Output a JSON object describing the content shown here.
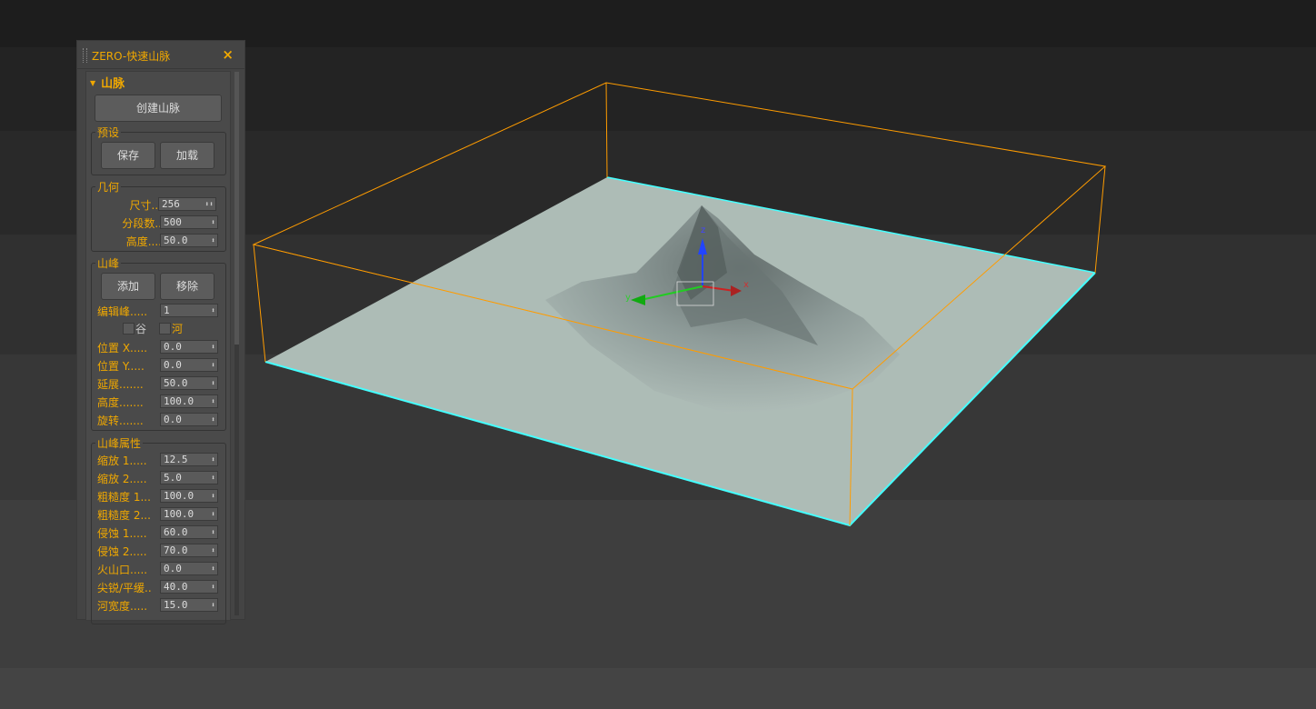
{
  "panel": {
    "title": "ZERO-快速山脉",
    "close": "×",
    "rollout": "山脉",
    "create_button": "创建山脉",
    "preset": {
      "label": "预设",
      "save": "保存",
      "load": "加载"
    },
    "geometry": {
      "label": "几何",
      "fields": [
        {
          "label": "尺寸...",
          "value": "256"
        },
        {
          "label": "分段数..",
          "value": "500"
        },
        {
          "label": "高度....",
          "value": "50.0"
        }
      ]
    },
    "peak": {
      "label": "山峰",
      "add": "添加",
      "remove": "移除",
      "edit_label": "编辑峰.....",
      "edit_value": "1",
      "valley": "谷",
      "river": "河",
      "fields": [
        {
          "label": "位置 X.....",
          "value": "0.0"
        },
        {
          "label": "位置 Y.....",
          "value": "0.0"
        },
        {
          "label": "延展.......",
          "value": "50.0"
        },
        {
          "label": "高度.......",
          "value": "100.0"
        },
        {
          "label": "旋转.......",
          "value": "0.0"
        }
      ]
    },
    "props": {
      "label": "山峰属性",
      "fields": [
        {
          "label": "缩放 1.....",
          "value": "12.5"
        },
        {
          "label": "缩放 2.....",
          "value": "5.0"
        },
        {
          "label": "粗糙度 1...",
          "value": "100.0"
        },
        {
          "label": "粗糙度 2...",
          "value": "100.0"
        },
        {
          "label": "侵蚀 1.....",
          "value": "60.0"
        },
        {
          "label": "侵蚀 2.....",
          "value": "70.0"
        },
        {
          "label": "火山口.....",
          "value": "0.0"
        },
        {
          "label": "尖锐/平缓..",
          "value": "40.0"
        },
        {
          "label": "河宽度.....",
          "value": "15.0"
        }
      ]
    }
  },
  "viewport": {
    "gizmo_z": "z",
    "gizmo_x": "x",
    "gizmo_y": "y",
    "accent": "#f0a800",
    "selection": "#ff9c00",
    "edge": "#4ff"
  }
}
